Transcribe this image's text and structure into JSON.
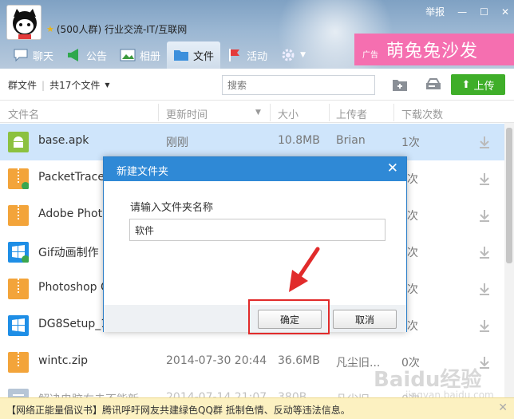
{
  "header": {
    "group_name": "(500人群) 行业交流-IT/互联网",
    "report": "举报",
    "tabs": [
      {
        "label": "聊天"
      },
      {
        "label": "公告"
      },
      {
        "label": "相册"
      },
      {
        "label": "文件"
      },
      {
        "label": "活动"
      }
    ],
    "ad_tag": "广告",
    "ad_text": "萌兔兔沙发"
  },
  "toolbar": {
    "crumb_root": "群文件",
    "crumb_count": "共17个文件",
    "search_placeholder": "搜索",
    "upload_label": "上传"
  },
  "columns": {
    "name": "文件名",
    "time": "更新时间",
    "size": "大小",
    "uploader": "上传者",
    "downloads": "下载次数"
  },
  "files": [
    {
      "name": "base.apk",
      "time": "刚刚",
      "size": "10.8MB",
      "uploader": "Brian",
      "downloads": "1次"
    },
    {
      "name": "PacketTrace",
      "time": "",
      "size": "",
      "uploader": "",
      "downloads": "次"
    },
    {
      "name": "Adobe Phot",
      "time": "",
      "size": "",
      "uploader": "",
      "downloads": "次"
    },
    {
      "name": "Gif动画制作",
      "time": "",
      "size": "",
      "uploader": "",
      "downloads": "次"
    },
    {
      "name": "Photoshop C",
      "time": "",
      "size": "",
      "uploader": "",
      "downloads": "次"
    },
    {
      "name": "DG8Setup_1",
      "time": "",
      "size": "",
      "uploader": "",
      "downloads": "次"
    },
    {
      "name": "wintc.zip",
      "time": "2014-07-30 20:44",
      "size": "36.6MB",
      "uploader": "凡尘旧...",
      "downloads": "0次"
    },
    {
      "name": "解决电脑右击不能新",
      "time": "2014-07-14 21:07",
      "size": "380B",
      "uploader": "凡尘旧...",
      "downloads": "0次"
    }
  ],
  "notice": {
    "text": "【网络正能量倡议书】腾讯呼吁网友共建绿色QQ群 抵制色情、反动等违法信息。"
  },
  "dialog": {
    "title": "新建文件夹",
    "label": "请输入文件夹名称",
    "value": "软件",
    "ok": "确定",
    "cancel": "取消"
  },
  "watermark": {
    "text": "Baidu经验",
    "sub": "jingyan.baidu.com"
  },
  "colors": {
    "accent": "#2f89d6",
    "upload": "#3fae29",
    "selected_row": "#cfe5fb",
    "annotation": "#e12b2b"
  }
}
